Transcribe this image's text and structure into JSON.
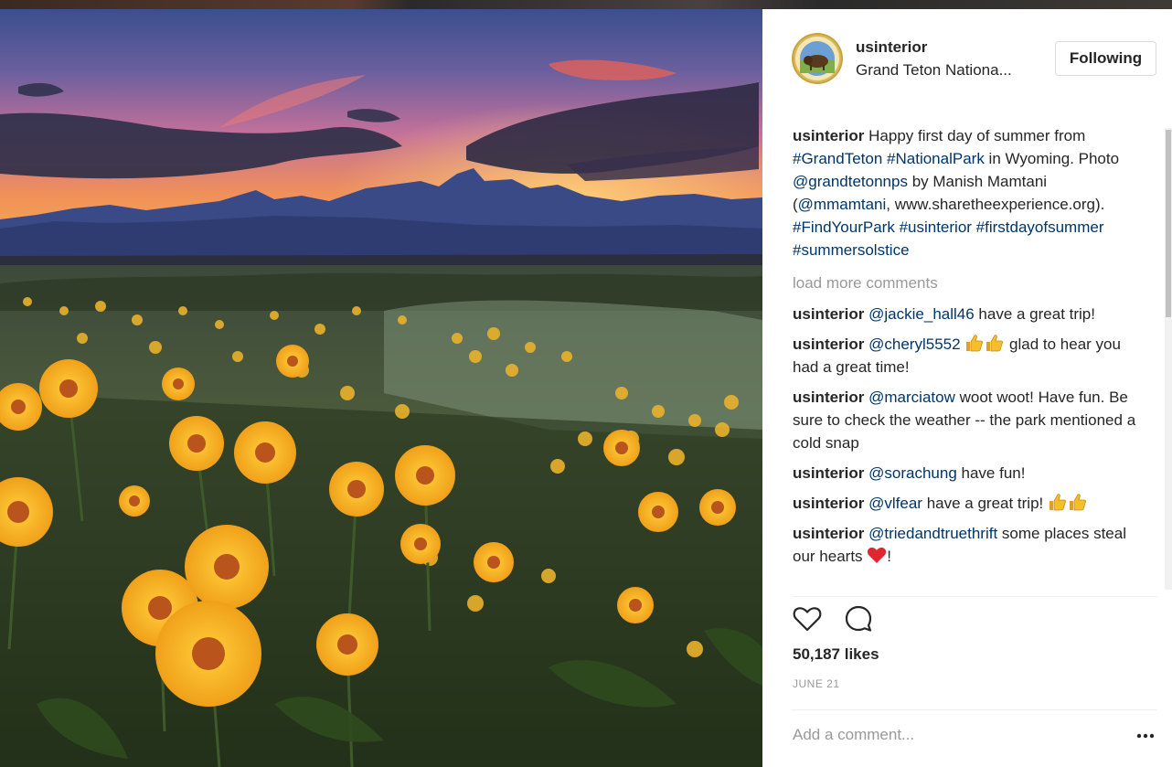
{
  "post": {
    "username": "usinterior",
    "location": "Grand Teton Nationa...",
    "follow_label": "Following"
  },
  "caption": {
    "username": "usinterior",
    "text_1": " Happy first day of summer from ",
    "tag_1": "#GrandTeton",
    "text_2": " ",
    "tag_2": "#NationalPark",
    "text_3": " in Wyoming. Photo ",
    "mention_1": "@grandtetonnps",
    "text_4": " by Manish Mamtani (",
    "mention_2": "@mmamtani",
    "text_5": ", www.sharetheexperience.org). ",
    "tag_3": "#FindYourPark",
    "text_6": " ",
    "tag_4": "#usinterior",
    "text_7": " ",
    "tag_5": "#firstdayofsummer",
    "text_8": " ",
    "tag_6": "#summersolstice"
  },
  "load_more": "load more comments",
  "comments": [
    {
      "user": "usinterior",
      "mention": "@jackie_hall46",
      "text": " have a great trip!"
    },
    {
      "user": "usinterior",
      "mention": "@cheryl5552",
      "text": " glad to hear you had a great time!",
      "emoji": "thumbs-up x2"
    },
    {
      "user": "usinterior",
      "mention": "@marciatow",
      "text": " woot woot! Have fun. Be sure to check the weather -- the park mentioned a cold snap"
    },
    {
      "user": "usinterior",
      "mention": "@sorachung",
      "text": " have fun!"
    },
    {
      "user": "usinterior",
      "mention": "@vlfear",
      "text": " have a great trip! ",
      "emoji": "thumbs-up x2"
    },
    {
      "user": "usinterior",
      "mention": "@triedandtruethrift",
      "text": " some places steal our hearts ",
      "emoji": "red-heart",
      "suffix": "!"
    }
  ],
  "likes": "50,187 likes",
  "date": "JUNE 21",
  "add_comment_placeholder": "Add a comment...",
  "icons": {
    "like": "heart-outline-icon",
    "comment": "speech-bubble-icon",
    "more": "ellipsis-icon",
    "avatar": "us-interior-seal-bison"
  },
  "colors": {
    "text": "#262626",
    "link": "#003569",
    "muted": "#999999",
    "border": "#dbdbdb"
  }
}
